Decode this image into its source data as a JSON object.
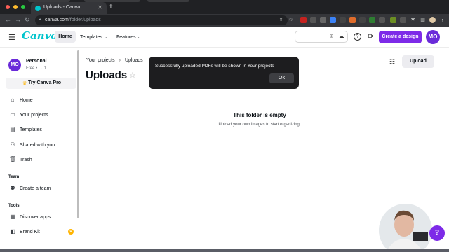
{
  "browser": {
    "active_tab_title": "Uploads - Canva",
    "new_tab_label": "+",
    "url_host": "canva.com",
    "url_path": "/folder/uploads",
    "back_glyph": "←",
    "forward_glyph": "→",
    "reload_glyph": "↻"
  },
  "app": {
    "logo": "Canva",
    "nav": {
      "home": "Home",
      "templates": "Templates",
      "features": "Features",
      "chevron": "⌄"
    },
    "create_design": "Create a design",
    "avatar_initials": "MO",
    "help_label": "?"
  },
  "sidebar": {
    "account_name": "Personal",
    "account_plan": "Free • → 1",
    "avatar_initials": "MO",
    "try_pro": "Try Canva Pro",
    "items": [
      {
        "label": "Home"
      },
      {
        "label": "Your projects"
      },
      {
        "label": "Templates"
      },
      {
        "label": "Shared with you"
      },
      {
        "label": "Trash"
      }
    ],
    "team_heading": "Team",
    "team_items": [
      {
        "label": "Create a team"
      }
    ],
    "tools_heading": "Tools",
    "tools_items": [
      {
        "label": "Discover apps"
      },
      {
        "label": "Brand Kit"
      }
    ]
  },
  "main": {
    "breadcrumb": [
      "Your projects",
      "Uploads"
    ],
    "breadcrumb_sep": "›",
    "title": "Uploads",
    "upload_button": "Upload",
    "empty_title": "This folder is empty",
    "empty_subtitle": "Upload your own images to start organizing."
  },
  "toast": {
    "message": "Successfully uploaded PDFs will be shown in Your projects",
    "ok": "Ok"
  },
  "colors": {
    "accent": "#7d2ae8",
    "brand": "#00c4cc",
    "avatar": "#6a2bd9"
  }
}
